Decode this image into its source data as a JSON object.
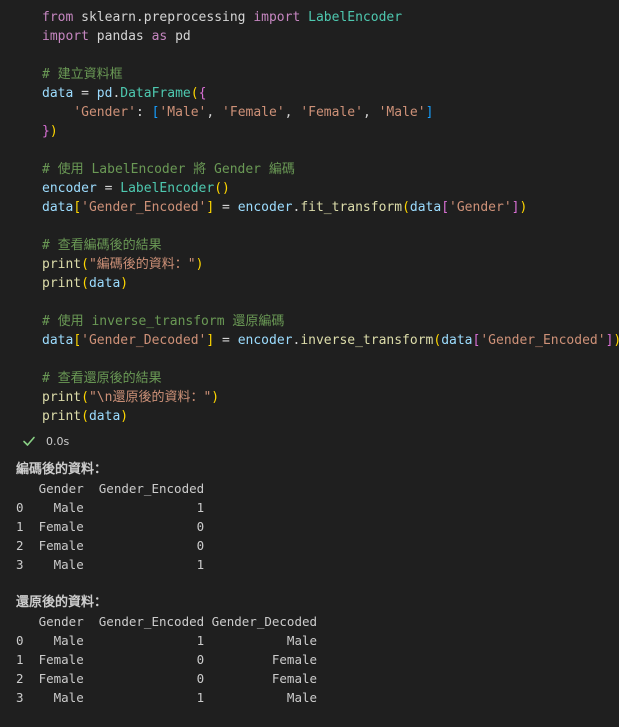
{
  "code_lines": [
    [
      [
        "kw",
        "from"
      ],
      [
        "op",
        " sklearn.preprocessing "
      ],
      [
        "kw",
        "import"
      ],
      [
        "op",
        " "
      ],
      [
        "cls",
        "LabelEncoder"
      ]
    ],
    [
      [
        "kw",
        "import"
      ],
      [
        "op",
        " pandas "
      ],
      [
        "kw",
        "as"
      ],
      [
        "op",
        " pd"
      ]
    ],
    [],
    [
      [
        "cmt",
        "# 建立資料框"
      ]
    ],
    [
      [
        "var",
        "data"
      ],
      [
        "op",
        " = "
      ],
      [
        "var",
        "pd"
      ],
      [
        "op",
        "."
      ],
      [
        "cls",
        "DataFrame"
      ],
      [
        "b1",
        "("
      ],
      [
        "b2",
        "{"
      ]
    ],
    [
      [
        "op",
        "    "
      ],
      [
        "str",
        "'Gender'"
      ],
      [
        "op",
        ": "
      ],
      [
        "b3",
        "["
      ],
      [
        "str",
        "'Male'"
      ],
      [
        "op",
        ", "
      ],
      [
        "str",
        "'Female'"
      ],
      [
        "op",
        ", "
      ],
      [
        "str",
        "'Female'"
      ],
      [
        "op",
        ", "
      ],
      [
        "str",
        "'Male'"
      ],
      [
        "b3",
        "]"
      ]
    ],
    [
      [
        "b2",
        "}"
      ],
      [
        "b1",
        ")"
      ]
    ],
    [],
    [
      [
        "cmt",
        "# 使用 LabelEncoder 將 Gender 編碼"
      ]
    ],
    [
      [
        "var",
        "encoder"
      ],
      [
        "op",
        " = "
      ],
      [
        "cls",
        "LabelEncoder"
      ],
      [
        "b1",
        "()"
      ]
    ],
    [
      [
        "var",
        "data"
      ],
      [
        "b1",
        "["
      ],
      [
        "str",
        "'Gender_Encoded'"
      ],
      [
        "b1",
        "]"
      ],
      [
        "op",
        " = "
      ],
      [
        "var",
        "encoder"
      ],
      [
        "op",
        "."
      ],
      [
        "fn",
        "fit_transform"
      ],
      [
        "b1",
        "("
      ],
      [
        "var",
        "data"
      ],
      [
        "b2",
        "["
      ],
      [
        "str",
        "'Gender'"
      ],
      [
        "b2",
        "]"
      ],
      [
        "b1",
        ")"
      ]
    ],
    [],
    [
      [
        "cmt",
        "# 查看編碼後的結果"
      ]
    ],
    [
      [
        "fn",
        "print"
      ],
      [
        "b1",
        "("
      ],
      [
        "str",
        "\"編碼後的資料：\""
      ],
      [
        "b1",
        ")"
      ]
    ],
    [
      [
        "fn",
        "print"
      ],
      [
        "b1",
        "("
      ],
      [
        "var",
        "data"
      ],
      [
        "b1",
        ")"
      ]
    ],
    [],
    [
      [
        "cmt",
        "# 使用 inverse_transform 還原編碼"
      ]
    ],
    [
      [
        "var",
        "data"
      ],
      [
        "b1",
        "["
      ],
      [
        "str",
        "'Gender_Decoded'"
      ],
      [
        "b1",
        "]"
      ],
      [
        "op",
        " = "
      ],
      [
        "var",
        "encoder"
      ],
      [
        "op",
        "."
      ],
      [
        "fn",
        "inverse_transform"
      ],
      [
        "b1",
        "("
      ],
      [
        "var",
        "data"
      ],
      [
        "b2",
        "["
      ],
      [
        "str",
        "'Gender_Encoded'"
      ],
      [
        "b2",
        "]"
      ],
      [
        "b1",
        ")"
      ]
    ],
    [],
    [
      [
        "cmt",
        "# 查看還原後的結果"
      ]
    ],
    [
      [
        "fn",
        "print"
      ],
      [
        "b1",
        "("
      ],
      [
        "str",
        "\"\\n還原後的資料：\""
      ],
      [
        "b1",
        ")"
      ]
    ],
    [
      [
        "fn",
        "print"
      ],
      [
        "b1",
        "("
      ],
      [
        "var",
        "data"
      ],
      [
        "b1",
        ")"
      ]
    ]
  ],
  "status": {
    "icon": "check-icon",
    "duration": "0.0s",
    "color": "#89d185"
  },
  "output_lines": [
    {
      "text": "編碼後的資料：",
      "heading": true
    },
    {
      "text": "   Gender  Gender_Encoded",
      "heading": false
    },
    {
      "text": "0    Male               1",
      "heading": false
    },
    {
      "text": "1  Female               0",
      "heading": false
    },
    {
      "text": "2  Female               0",
      "heading": false
    },
    {
      "text": "3    Male               1",
      "heading": false
    },
    {
      "text": "",
      "heading": false
    },
    {
      "text": "還原後的資料：",
      "heading": true
    },
    {
      "text": "   Gender  Gender_Encoded Gender_Decoded",
      "heading": false
    },
    {
      "text": "0    Male               1           Male",
      "heading": false
    },
    {
      "text": "1  Female               0         Female",
      "heading": false
    },
    {
      "text": "2  Female               0         Female",
      "heading": false
    },
    {
      "text": "3    Male               1           Male",
      "heading": false
    }
  ]
}
